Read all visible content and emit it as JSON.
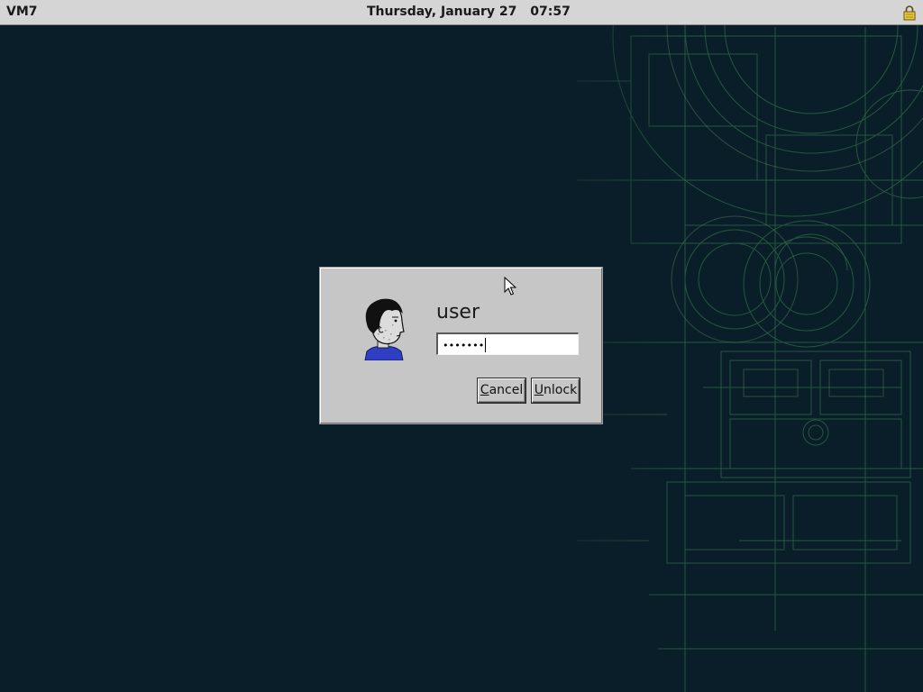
{
  "topbar": {
    "hostname": "VM7",
    "date": "Thursday, January 27",
    "time": "07:57",
    "lock_icon": "padlock-icon"
  },
  "dialog": {
    "avatar_icon": "user-face-avatar-icon",
    "username": "user",
    "password_mask": "•••••••",
    "cancel": {
      "mnemonic": "C",
      "rest": "ancel"
    },
    "unlock": {
      "mnemonic": "U",
      "rest": "nlock"
    }
  },
  "colors": {
    "desktop_background": "#0a1e29",
    "blueprint_lines": "#2f6a45",
    "panel_gray": "#d5d5d5",
    "dialog_gray": "#c6c6c6",
    "avatar_shirt": "#2f3fc4"
  }
}
